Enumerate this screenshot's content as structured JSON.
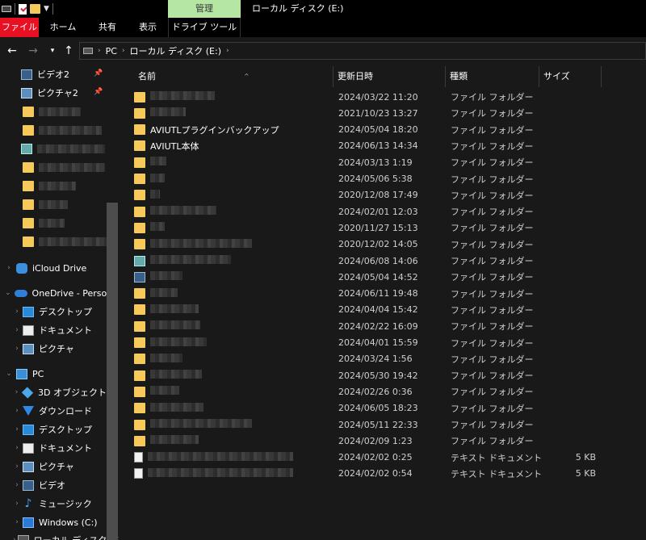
{
  "titlebar": {
    "context_tab": "管理",
    "window_title": "ローカル ディスク (E:)"
  },
  "ribbon": {
    "tabs": [
      "ファイル",
      "ホーム",
      "共有",
      "表示",
      "ドライブ ツール"
    ]
  },
  "address": {
    "segments": [
      "PC",
      "ローカル ディスク (E:)"
    ]
  },
  "sidebar": {
    "items": [
      {
        "label": "ビデオ2",
        "icon": "video-icon",
        "pinned": true
      },
      {
        "label": "ピクチャ2",
        "icon": "pictures-icon",
        "pinned": true
      },
      {
        "label": "",
        "icon": "folder-icon"
      },
      {
        "label": "",
        "icon": "folder-icon"
      },
      {
        "label": "",
        "icon": "network-icon"
      },
      {
        "label": "",
        "icon": "folder-icon"
      },
      {
        "label": "",
        "icon": "folder-icon"
      },
      {
        "label": "",
        "icon": "folder-icon"
      },
      {
        "label": "",
        "icon": "folder-icon"
      },
      {
        "label": "",
        "icon": "folder-icon"
      },
      {
        "label": "iCloud Drive",
        "icon": "icloud-icon"
      },
      {
        "label": "OneDrive - Person",
        "icon": "onedrive-icon"
      },
      {
        "label": "デスクトップ",
        "icon": "desktop-icon"
      },
      {
        "label": "ドキュメント",
        "icon": "documents-icon"
      },
      {
        "label": "ピクチャ",
        "icon": "pictures-icon"
      },
      {
        "label": "PC",
        "icon": "pc-icon"
      },
      {
        "label": "3D オブジェクト",
        "icon": "3d-objects-icon"
      },
      {
        "label": "ダウンロード",
        "icon": "downloads-icon"
      },
      {
        "label": "デスクトップ",
        "icon": "desktop-icon"
      },
      {
        "label": "ドキュメント",
        "icon": "documents-icon"
      },
      {
        "label": "ピクチャ",
        "icon": "pictures-icon"
      },
      {
        "label": "ビデオ",
        "icon": "video-icon"
      },
      {
        "label": "ミュージック",
        "icon": "music-icon"
      },
      {
        "label": "Windows (C:)",
        "icon": "drive-c-icon"
      },
      {
        "label": "ローカル ディスク (E:)",
        "icon": "drive-e-icon"
      }
    ]
  },
  "columns": {
    "name": "名前",
    "date": "更新日時",
    "type": "種類",
    "size": "サイズ"
  },
  "files": [
    {
      "name": "",
      "date": "2024/03/22 11:20",
      "type": "ファイル フォルダー",
      "size": "",
      "icon": "folder-icon"
    },
    {
      "name": "",
      "date": "2021/10/23 13:27",
      "type": "ファイル フォルダー",
      "size": "",
      "icon": "folder-icon"
    },
    {
      "name": "AVIUTLプラグインバックアップ",
      "date": "2024/05/04 18:20",
      "type": "ファイル フォルダー",
      "size": "",
      "icon": "folder-icon"
    },
    {
      "name": "AVIUTL本体",
      "date": "2024/06/13 14:34",
      "type": "ファイル フォルダー",
      "size": "",
      "icon": "folder-icon"
    },
    {
      "name": "",
      "date": "2024/03/13 1:19",
      "type": "ファイル フォルダー",
      "size": "",
      "icon": "folder-icon"
    },
    {
      "name": "",
      "date": "2024/05/06 5:38",
      "type": "ファイル フォルダー",
      "size": "",
      "icon": "folder-icon"
    },
    {
      "name": "",
      "date": "2020/12/08 17:49",
      "type": "ファイル フォルダー",
      "size": "",
      "icon": "folder-icon"
    },
    {
      "name": "",
      "date": "2024/02/01 12:03",
      "type": "ファイル フォルダー",
      "size": "",
      "icon": "folder-icon"
    },
    {
      "name": "",
      "date": "2020/11/27 15:13",
      "type": "ファイル フォルダー",
      "size": "",
      "icon": "folder-icon"
    },
    {
      "name": "",
      "date": "2020/12/02 14:05",
      "type": "ファイル フォルダー",
      "size": "",
      "icon": "folder-icon"
    },
    {
      "name": "",
      "date": "2024/06/08 14:06",
      "type": "ファイル フォルダー",
      "size": "",
      "icon": "network-icon"
    },
    {
      "name": "",
      "date": "2024/05/04 14:52",
      "type": "ファイル フォルダー",
      "size": "",
      "icon": "video-icon"
    },
    {
      "name": "",
      "date": "2024/06/11 19:48",
      "type": "ファイル フォルダー",
      "size": "",
      "icon": "folder-icon"
    },
    {
      "name": "",
      "date": "2024/04/04 15:42",
      "type": "ファイル フォルダー",
      "size": "",
      "icon": "folder-icon"
    },
    {
      "name": "",
      "date": "2024/02/22 16:09",
      "type": "ファイル フォルダー",
      "size": "",
      "icon": "folder-icon"
    },
    {
      "name": "",
      "date": "2024/04/01 15:59",
      "type": "ファイル フォルダー",
      "size": "",
      "icon": "folder-icon"
    },
    {
      "name": "",
      "date": "2024/03/24 1:56",
      "type": "ファイル フォルダー",
      "size": "",
      "icon": "folder-icon"
    },
    {
      "name": "",
      "date": "2024/05/30 19:42",
      "type": "ファイル フォルダー",
      "size": "",
      "icon": "folder-icon"
    },
    {
      "name": "",
      "date": "2024/02/26 0:36",
      "type": "ファイル フォルダー",
      "size": "",
      "icon": "folder-icon"
    },
    {
      "name": "",
      "date": "2024/06/05 18:23",
      "type": "ファイル フォルダー",
      "size": "",
      "icon": "folder-icon"
    },
    {
      "name": "",
      "date": "2024/05/11 22:33",
      "type": "ファイル フォルダー",
      "size": "",
      "icon": "folder-icon"
    },
    {
      "name": "",
      "date": "2024/02/09 1:23",
      "type": "ファイル フォルダー",
      "size": "",
      "icon": "folder-icon"
    },
    {
      "name": "",
      "date": "2024/02/02 0:25",
      "type": "テキスト ドキュメント",
      "size": "5 KB",
      "icon": "text-file-icon"
    },
    {
      "name": "",
      "date": "2024/02/02 0:54",
      "type": "テキスト ドキュメント",
      "size": "5 KB",
      "icon": "text-file-icon"
    }
  ],
  "colors": {
    "background": "#191919",
    "file_tab": "#e81123",
    "context_tab": "#b6e6a4",
    "folder": "#f6c95b"
  }
}
